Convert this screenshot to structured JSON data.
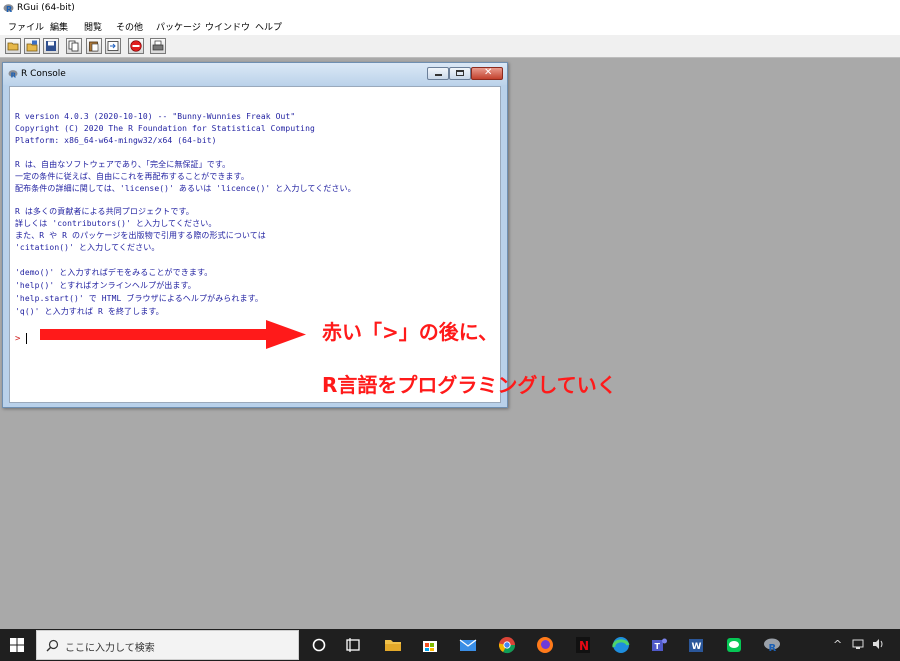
{
  "app": {
    "title": "RGui (64-bit)"
  },
  "menu": [
    "ファイル",
    "編集",
    "閲覧",
    "その他",
    "パッケージ",
    "ウインドウ",
    "ヘルプ"
  ],
  "toolbar": {
    "icons": [
      "open-script-icon",
      "load-workspace-icon",
      "save-workspace-icon",
      "copy-icon",
      "paste-icon",
      "copy-paste-icon",
      "stop-icon",
      "print-icon"
    ]
  },
  "console": {
    "title": "R Console",
    "lines": [
      "R version 4.0.3 (2020-10-10) -- \"Bunny-Wunnies Freak Out\"",
      "Copyright (C) 2020 The R Foundation for Statistical Computing",
      "Platform: x86_64-w64-mingw32/x64 (64-bit)",
      "",
      "R は、自由なソフトウェアであり、「完全に無保証」です。",
      "一定の条件に従えば、自由にこれを再配布することができます。",
      "配布条件の詳細に関しては、'license()' あるいは 'licence()' と入力してください。",
      "",
      "R は多くの貢献者による共同プロジェクトです。",
      "詳しくは 'contributors()' と入力してください。",
      "また、R や R のパッケージを出版物で引用する際の形式については",
      "'citation()' と入力してください。",
      "",
      "'demo()' と入力すればデモをみることができます。",
      "'help()' とすればオンラインヘルプが出ます。",
      "'help.start()' で HTML ブラウザによるヘルプがみられます。",
      "'q()' と入力すれば R を終了します。"
    ],
    "prompt": ">"
  },
  "annotation": {
    "line1": "赤い「>」の後に、",
    "line2": "R言語をプログラミングしていく",
    "color": "#ff1a1a"
  },
  "taskbar": {
    "search_placeholder": "ここに入力して検索",
    "apps": [
      "cortana-icon",
      "task-view-icon",
      "file-explorer-icon",
      "store-icon",
      "mail-icon",
      "chrome-icon",
      "firefox-icon",
      "netflix-icon",
      "edge-icon",
      "teams-icon",
      "word-icon",
      "line-icon",
      "rgui-icon"
    ],
    "tray": [
      "chevron-up-icon",
      "network-icon",
      "volume-icon"
    ]
  }
}
